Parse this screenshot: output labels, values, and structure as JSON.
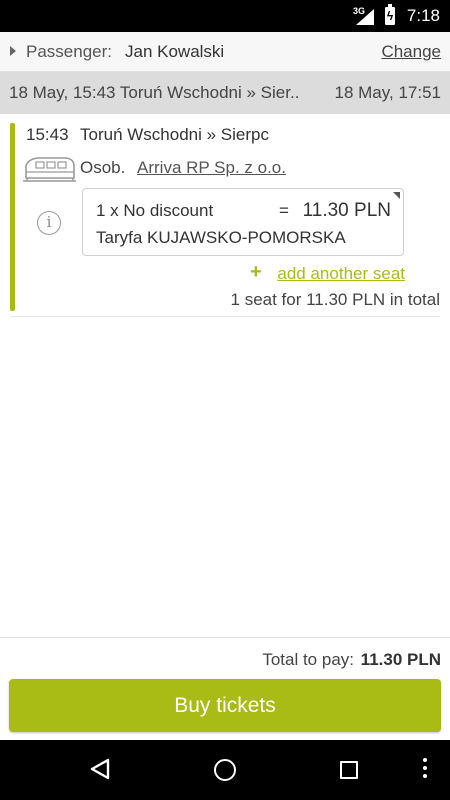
{
  "status_bar": {
    "network": "3G",
    "time": "7:18"
  },
  "passenger": {
    "label": "Passenger:",
    "name": "Jan Kowalski",
    "change_label": "Change"
  },
  "route_header": {
    "departure": "18 May, 15:43 Toruń Wschodni » Sier..",
    "arrival": "18 May, 17:51"
  },
  "segment": {
    "time": "15:43",
    "route": "Toruń Wschodni » Sierpc",
    "train_type": "Osob.",
    "carrier": "Arriva RP Sp. z o.o.",
    "ticket": {
      "quantity_discount": "1 x No discount",
      "equals": "=",
      "price": "11.30 PLN",
      "tariff": "Taryfa KUJAWSKO-POMORSKA"
    },
    "add_seat_plus": "+",
    "add_seat_label": "add another seat",
    "seat_total": "1 seat for 11.30 PLN in total"
  },
  "summary": {
    "total_label": "Total to pay:",
    "total_value": "11.30 PLN",
    "buy_label": "Buy tickets"
  },
  "colors": {
    "accent": "#a9bc16",
    "route_header_bg": "#dcdcdc"
  },
  "icons": {
    "info": "i",
    "train": "train-icon",
    "back": "back-triangle-icon",
    "home": "home-circle-icon",
    "recent": "recent-apps-icon",
    "menu": "overflow-menu-icon"
  }
}
